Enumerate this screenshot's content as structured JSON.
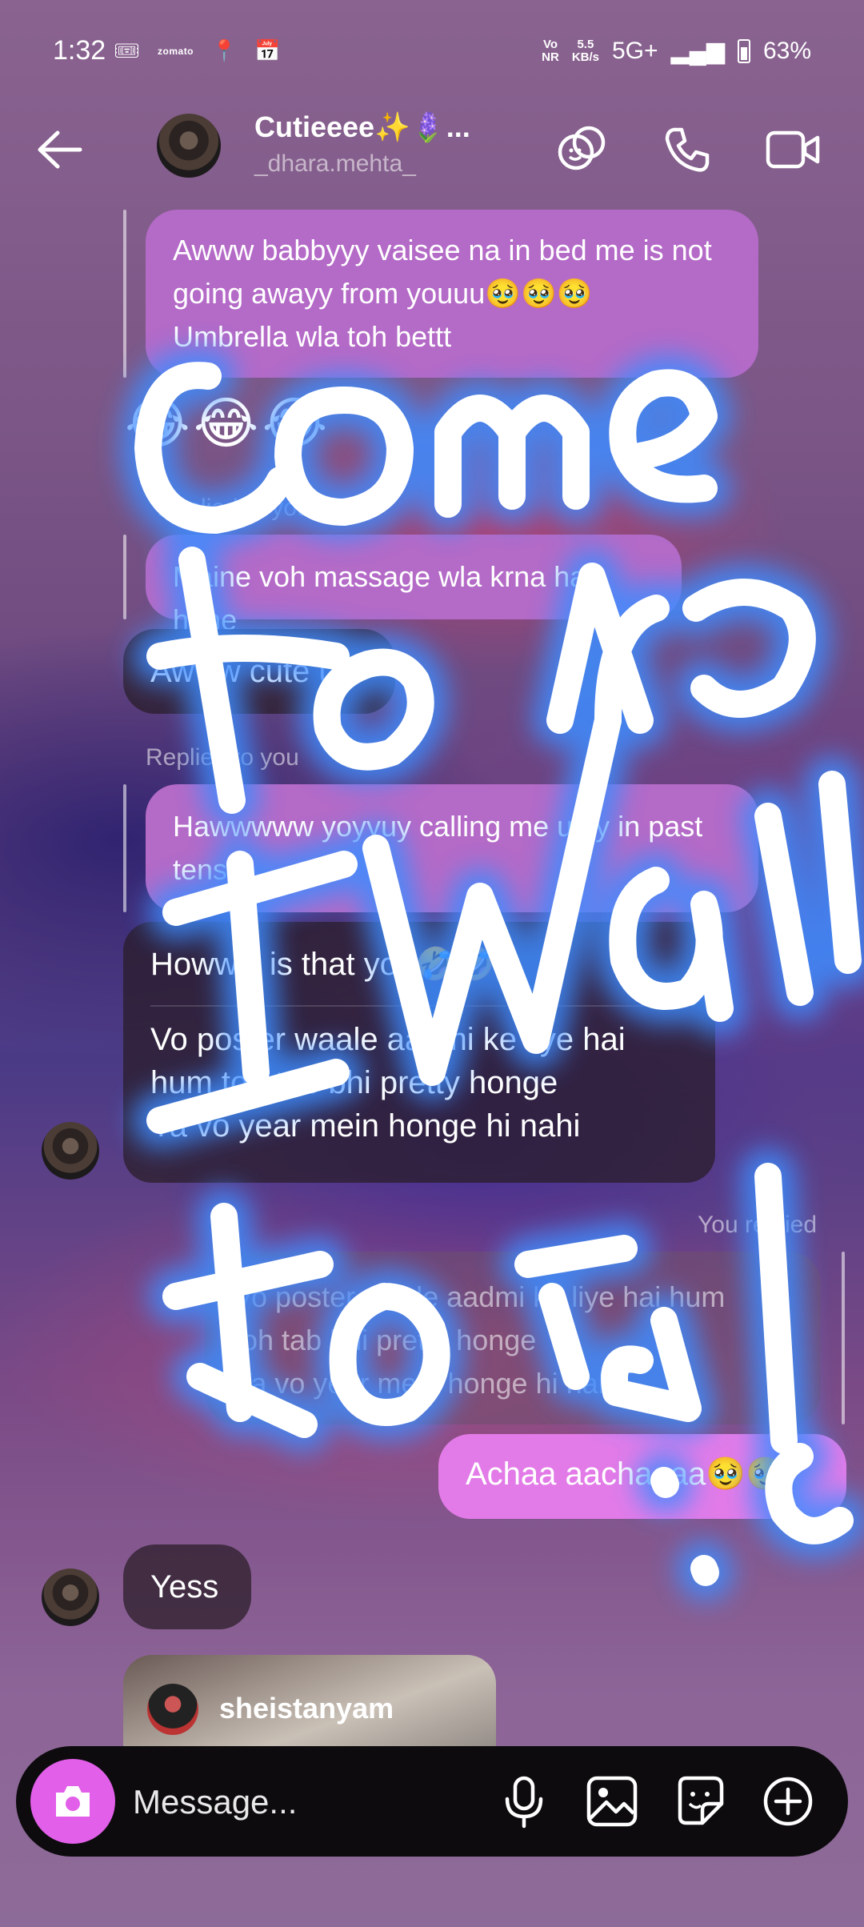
{
  "status": {
    "time": "1:32",
    "zomato": "zomato",
    "network_top": "Vo",
    "network_bottom": "NR",
    "speed_top": "5.5",
    "speed_bottom": "KB/s",
    "signal": "5G+",
    "battery": "63%"
  },
  "header": {
    "name": "Cutieeee✨🪻...",
    "handle": "_dhara.mehta_"
  },
  "messages": [
    {
      "text_line1": "Awww babbyyy vaisee na in bed me is not",
      "text_line2": "going awayy from youuu🥹🥹🥹",
      "text_line3": "Umbrella wla toh bettt"
    },
    {
      "emojis": "😂😂😂"
    },
    {
      "replied_label": "Replied to you"
    },
    {
      "text": "Maine voh massage wla krna hai hehe"
    },
    {
      "text": "Awww cute u"
    },
    {
      "replied_label": "Replied to you"
    },
    {
      "text_line1": "Hawwwww yoyyuy calling me ugly in past",
      "text_line2": "tense"
    },
    {
      "text_line1": "Howww is that you🤣🤣",
      "text_line2": "Vo poster waale aadmi ke liye hai",
      "text_line3": "hum toh tab bhi pretty honge",
      "text_line4": "Ya vo year mein honge hi nahi"
    },
    {
      "replied_label": "You replied"
    },
    {
      "text_line1": "Vo poster waale aadmi ke liye hai hum",
      "text_line2": "toh tab bhi pretty honge",
      "text_line3": "Ya vo year mein honge hi nahi"
    },
    {
      "text": "Achaa aachaaaa🥹🥹"
    },
    {
      "text": "Yess"
    },
    {
      "text": "sheistanyam"
    }
  ],
  "composer": {
    "placeholder": "Message..."
  },
  "scribble_text": "Come to me I want to talk"
}
